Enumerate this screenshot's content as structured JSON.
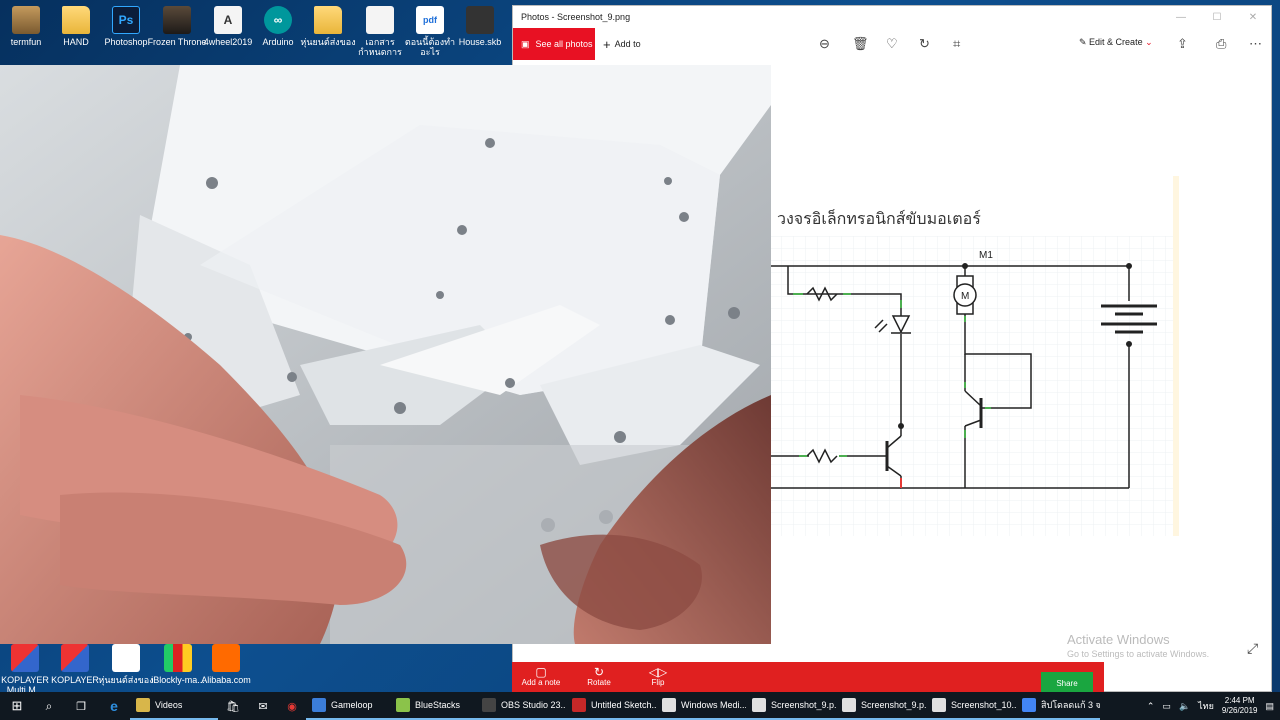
{
  "desktop_icons_top": [
    {
      "label": "termfun",
      "type": "user"
    },
    {
      "label": "HAND",
      "type": "folder"
    },
    {
      "label": "Photoshop",
      "type": "ps",
      "glyph": "Ps"
    },
    {
      "label": "Frozen Throne",
      "type": "game"
    },
    {
      "label": "4wheel2019",
      "type": "doc",
      "glyph": "A"
    },
    {
      "label": "Arduino",
      "type": "arduino",
      "glyph": "∞"
    },
    {
      "label": "หุ่นยนต์ส่งของ",
      "type": "folder"
    },
    {
      "label": "เอกสารกำหนดการ",
      "type": "doc"
    },
    {
      "label": "ตอนนี้ต้องทำอะไร",
      "type": "pdf",
      "glyph": "pdf"
    },
    {
      "label": "House.skb",
      "type": "skb"
    }
  ],
  "desktop_icons_bottom": [
    {
      "label": "KOPLAYER Multi M...",
      "type": "ko"
    },
    {
      "label": "KOPLAYER",
      "type": "ko"
    },
    {
      "label": "หุ่นยนต์ส่งของ",
      "type": "kids"
    },
    {
      "label": "iBlockly-ma...",
      "type": "ib"
    },
    {
      "label": "Alibaba.com",
      "type": "ali"
    }
  ],
  "photos": {
    "title": "Photos - Screenshot_9.png",
    "see_all": "See all photos",
    "add_to": "Add to",
    "edit_create": "Edit & Create",
    "schematic_title": "วงจรอิเล็กทรอนิกส์ขับมอเตอร์",
    "motor_label": "M1",
    "motor_symbol": "M",
    "activate_line1": "Activate Windows",
    "activate_line2": "Go to Settings to activate Windows."
  },
  "bottom_bar": {
    "add_note": "Add a note",
    "rotate": "Rotate",
    "flip": "Flip",
    "share": "Share"
  },
  "taskbar": {
    "apps": [
      {
        "label": "Videos",
        "color": "#d8b64a"
      },
      {
        "label": "Gameloop",
        "color": "#3b7dd8"
      },
      {
        "label": "BlueStacks",
        "color": "#8bc34a"
      },
      {
        "label": "OBS Studio 23....",
        "color": "#444444"
      },
      {
        "label": "Untitled Sketch...",
        "color": "#c62828"
      },
      {
        "label": "Windows Medi...",
        "color": "#e0e0e0"
      },
      {
        "label": "Screenshot_9.p...",
        "color": "#e0e0e0"
      },
      {
        "label": "Screenshot_9.p...",
        "color": "#e0e0e0"
      },
      {
        "label": "Screenshot_10....",
        "color": "#e0e0e0"
      },
      {
        "label": "สิปโดลดแก้ 3 จาก...",
        "color": "#4285f4"
      }
    ],
    "time": "2:44 PM",
    "date": "9/26/2019",
    "lang": "ไทย"
  }
}
